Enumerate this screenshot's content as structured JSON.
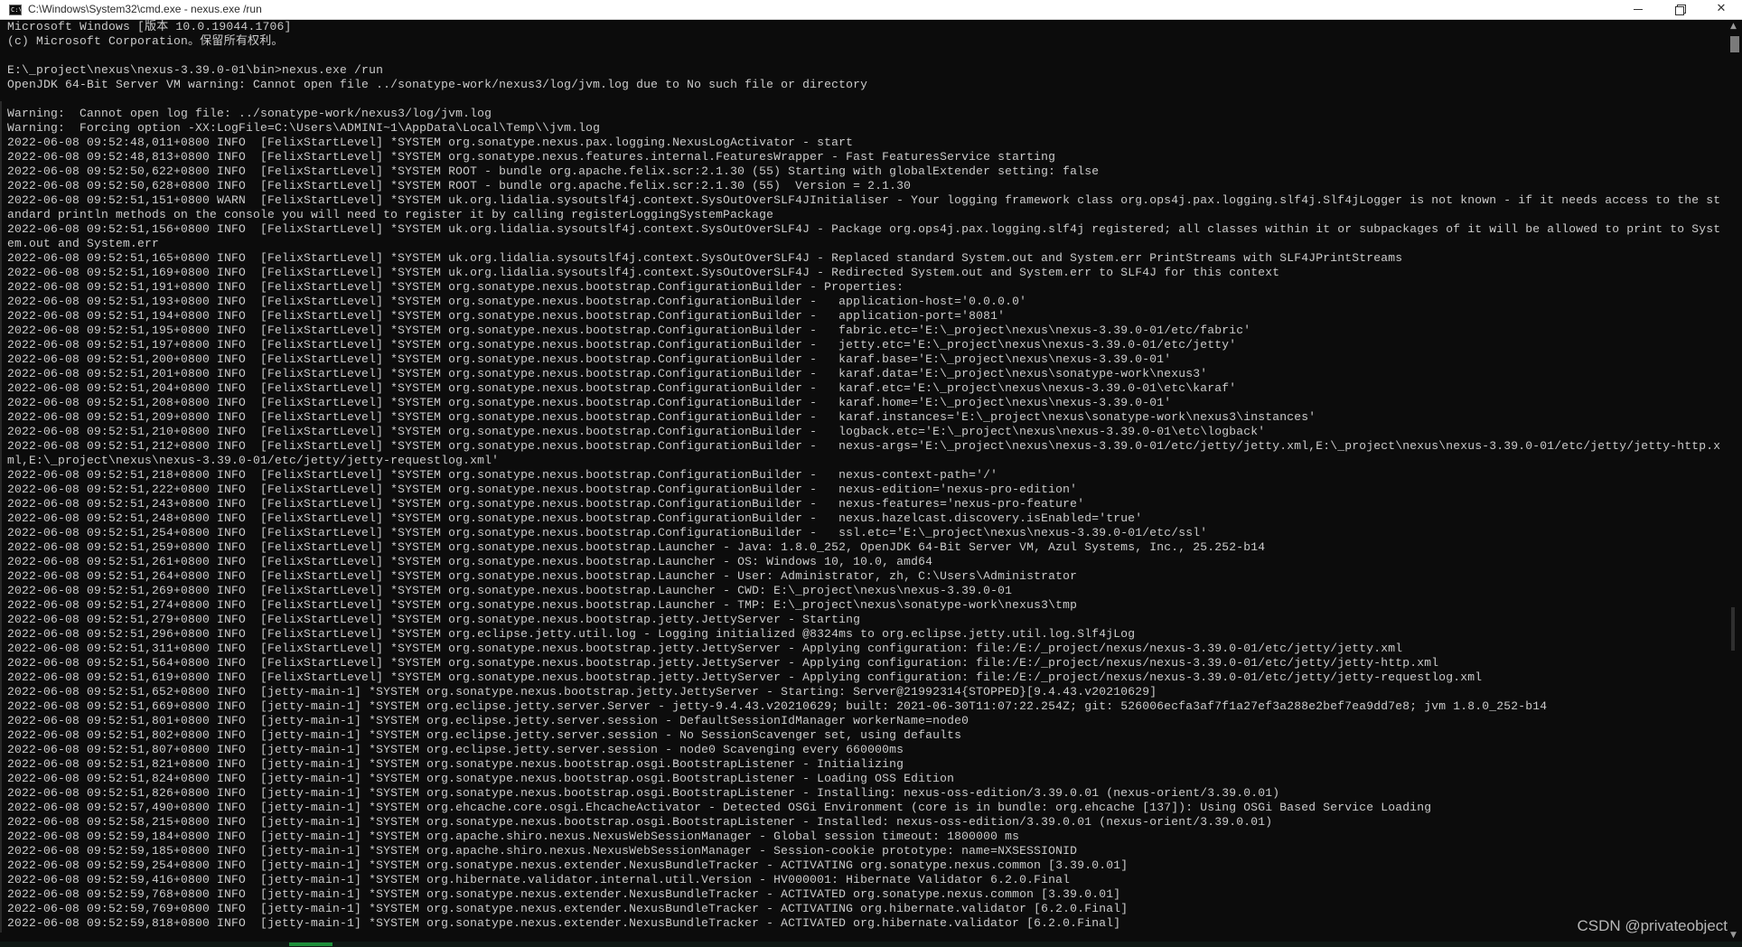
{
  "window": {
    "title": "C:\\Windows\\System32\\cmd.exe - nexus.exe  /run",
    "app_icon": "cmd-icon",
    "controls": {
      "minimize": "minimize-icon",
      "maximize": "restore-icon",
      "close_label": "✕"
    }
  },
  "console": {
    "lines": [
      "Microsoft Windows [版本 10.0.19044.1706]",
      "(c) Microsoft Corporation。保留所有权利。",
      "",
      "E:\\_project\\nexus\\nexus-3.39.0-01\\bin>nexus.exe /run",
      "OpenJDK 64-Bit Server VM warning: Cannot open file ../sonatype-work/nexus3/log/jvm.log due to No such file or directory",
      "",
      "Warning:  Cannot open log file: ../sonatype-work/nexus3/log/jvm.log",
      "Warning:  Forcing option -XX:LogFile=C:\\Users\\ADMINI~1\\AppData\\Local\\Temp\\\\jvm.log",
      "2022-06-08 09:52:48,011+0800 INFO  [FelixStartLevel] *SYSTEM org.sonatype.nexus.pax.logging.NexusLogActivator - start",
      "2022-06-08 09:52:48,813+0800 INFO  [FelixStartLevel] *SYSTEM org.sonatype.nexus.features.internal.FeaturesWrapper - Fast FeaturesService starting",
      "2022-06-08 09:52:50,622+0800 INFO  [FelixStartLevel] *SYSTEM ROOT - bundle org.apache.felix.scr:2.1.30 (55) Starting with globalExtender setting: false",
      "2022-06-08 09:52:50,628+0800 INFO  [FelixStartLevel] *SYSTEM ROOT - bundle org.apache.felix.scr:2.1.30 (55)  Version = 2.1.30",
      "2022-06-08 09:52:51,151+0800 WARN  [FelixStartLevel] *SYSTEM uk.org.lidalia.sysoutslf4j.context.SysOutOverSLF4JInitialiser - Your logging framework class org.ops4j.pax.logging.slf4j.Slf4jLogger is not known - if it needs access to the st",
      "andard println methods on the console you will need to register it by calling registerLoggingSystemPackage",
      "2022-06-08 09:52:51,156+0800 INFO  [FelixStartLevel] *SYSTEM uk.org.lidalia.sysoutslf4j.context.SysOutOverSLF4J - Package org.ops4j.pax.logging.slf4j registered; all classes within it or subpackages of it will be allowed to print to Syst",
      "em.out and System.err",
      "2022-06-08 09:52:51,165+0800 INFO  [FelixStartLevel] *SYSTEM uk.org.lidalia.sysoutslf4j.context.SysOutOverSLF4J - Replaced standard System.out and System.err PrintStreams with SLF4JPrintStreams",
      "2022-06-08 09:52:51,169+0800 INFO  [FelixStartLevel] *SYSTEM uk.org.lidalia.sysoutslf4j.context.SysOutOverSLF4J - Redirected System.out and System.err to SLF4J for this context",
      "2022-06-08 09:52:51,191+0800 INFO  [FelixStartLevel] *SYSTEM org.sonatype.nexus.bootstrap.ConfigurationBuilder - Properties:",
      "2022-06-08 09:52:51,193+0800 INFO  [FelixStartLevel] *SYSTEM org.sonatype.nexus.bootstrap.ConfigurationBuilder -   application-host='0.0.0.0'",
      "2022-06-08 09:52:51,194+0800 INFO  [FelixStartLevel] *SYSTEM org.sonatype.nexus.bootstrap.ConfigurationBuilder -   application-port='8081'",
      "2022-06-08 09:52:51,195+0800 INFO  [FelixStartLevel] *SYSTEM org.sonatype.nexus.bootstrap.ConfigurationBuilder -   fabric.etc='E:\\_project\\nexus\\nexus-3.39.0-01/etc/fabric'",
      "2022-06-08 09:52:51,197+0800 INFO  [FelixStartLevel] *SYSTEM org.sonatype.nexus.bootstrap.ConfigurationBuilder -   jetty.etc='E:\\_project\\nexus\\nexus-3.39.0-01/etc/jetty'",
      "2022-06-08 09:52:51,200+0800 INFO  [FelixStartLevel] *SYSTEM org.sonatype.nexus.bootstrap.ConfigurationBuilder -   karaf.base='E:\\_project\\nexus\\nexus-3.39.0-01'",
      "2022-06-08 09:52:51,201+0800 INFO  [FelixStartLevel] *SYSTEM org.sonatype.nexus.bootstrap.ConfigurationBuilder -   karaf.data='E:\\_project\\nexus\\sonatype-work\\nexus3'",
      "2022-06-08 09:52:51,204+0800 INFO  [FelixStartLevel] *SYSTEM org.sonatype.nexus.bootstrap.ConfigurationBuilder -   karaf.etc='E:\\_project\\nexus\\nexus-3.39.0-01\\etc\\karaf'",
      "2022-06-08 09:52:51,208+0800 INFO  [FelixStartLevel] *SYSTEM org.sonatype.nexus.bootstrap.ConfigurationBuilder -   karaf.home='E:\\_project\\nexus\\nexus-3.39.0-01'",
      "2022-06-08 09:52:51,209+0800 INFO  [FelixStartLevel] *SYSTEM org.sonatype.nexus.bootstrap.ConfigurationBuilder -   karaf.instances='E:\\_project\\nexus\\sonatype-work\\nexus3\\instances'",
      "2022-06-08 09:52:51,210+0800 INFO  [FelixStartLevel] *SYSTEM org.sonatype.nexus.bootstrap.ConfigurationBuilder -   logback.etc='E:\\_project\\nexus\\nexus-3.39.0-01\\etc\\logback'",
      "2022-06-08 09:52:51,212+0800 INFO  [FelixStartLevel] *SYSTEM org.sonatype.nexus.bootstrap.ConfigurationBuilder -   nexus-args='E:\\_project\\nexus\\nexus-3.39.0-01/etc/jetty/jetty.xml,E:\\_project\\nexus\\nexus-3.39.0-01/etc/jetty/jetty-http.x",
      "ml,E:\\_project\\nexus\\nexus-3.39.0-01/etc/jetty/jetty-requestlog.xml'",
      "2022-06-08 09:52:51,218+0800 INFO  [FelixStartLevel] *SYSTEM org.sonatype.nexus.bootstrap.ConfigurationBuilder -   nexus-context-path='/'",
      "2022-06-08 09:52:51,222+0800 INFO  [FelixStartLevel] *SYSTEM org.sonatype.nexus.bootstrap.ConfigurationBuilder -   nexus-edition='nexus-pro-edition'",
      "2022-06-08 09:52:51,243+0800 INFO  [FelixStartLevel] *SYSTEM org.sonatype.nexus.bootstrap.ConfigurationBuilder -   nexus-features='nexus-pro-feature'",
      "2022-06-08 09:52:51,248+0800 INFO  [FelixStartLevel] *SYSTEM org.sonatype.nexus.bootstrap.ConfigurationBuilder -   nexus.hazelcast.discovery.isEnabled='true'",
      "2022-06-08 09:52:51,254+0800 INFO  [FelixStartLevel] *SYSTEM org.sonatype.nexus.bootstrap.ConfigurationBuilder -   ssl.etc='E:\\_project\\nexus\\nexus-3.39.0-01/etc/ssl'",
      "2022-06-08 09:52:51,259+0800 INFO  [FelixStartLevel] *SYSTEM org.sonatype.nexus.bootstrap.Launcher - Java: 1.8.0_252, OpenJDK 64-Bit Server VM, Azul Systems, Inc., 25.252-b14",
      "2022-06-08 09:52:51,261+0800 INFO  [FelixStartLevel] *SYSTEM org.sonatype.nexus.bootstrap.Launcher - OS: Windows 10, 10.0, amd64",
      "2022-06-08 09:52:51,264+0800 INFO  [FelixStartLevel] *SYSTEM org.sonatype.nexus.bootstrap.Launcher - User: Administrator, zh, C:\\Users\\Administrator",
      "2022-06-08 09:52:51,269+0800 INFO  [FelixStartLevel] *SYSTEM org.sonatype.nexus.bootstrap.Launcher - CWD: E:\\_project\\nexus\\nexus-3.39.0-01",
      "2022-06-08 09:52:51,274+0800 INFO  [FelixStartLevel] *SYSTEM org.sonatype.nexus.bootstrap.Launcher - TMP: E:\\_project\\nexus\\sonatype-work\\nexus3\\tmp",
      "2022-06-08 09:52:51,279+0800 INFO  [FelixStartLevel] *SYSTEM org.sonatype.nexus.bootstrap.jetty.JettyServer - Starting",
      "2022-06-08 09:52:51,296+0800 INFO  [FelixStartLevel] *SYSTEM org.eclipse.jetty.util.log - Logging initialized @8324ms to org.eclipse.jetty.util.log.Slf4jLog",
      "2022-06-08 09:52:51,311+0800 INFO  [FelixStartLevel] *SYSTEM org.sonatype.nexus.bootstrap.jetty.JettyServer - Applying configuration: file:/E:/_project/nexus/nexus-3.39.0-01/etc/jetty/jetty.xml",
      "2022-06-08 09:52:51,564+0800 INFO  [FelixStartLevel] *SYSTEM org.sonatype.nexus.bootstrap.jetty.JettyServer - Applying configuration: file:/E:/_project/nexus/nexus-3.39.0-01/etc/jetty/jetty-http.xml",
      "2022-06-08 09:52:51,619+0800 INFO  [FelixStartLevel] *SYSTEM org.sonatype.nexus.bootstrap.jetty.JettyServer - Applying configuration: file:/E:/_project/nexus/nexus-3.39.0-01/etc/jetty/jetty-requestlog.xml",
      "2022-06-08 09:52:51,652+0800 INFO  [jetty-main-1] *SYSTEM org.sonatype.nexus.bootstrap.jetty.JettyServer - Starting: Server@21992314{STOPPED}[9.4.43.v20210629]",
      "2022-06-08 09:52:51,669+0800 INFO  [jetty-main-1] *SYSTEM org.eclipse.jetty.server.Server - jetty-9.4.43.v20210629; built: 2021-06-30T11:07:22.254Z; git: 526006ecfa3af7f1a27ef3a288e2bef7ea9dd7e8; jvm 1.8.0_252-b14",
      "2022-06-08 09:52:51,801+0800 INFO  [jetty-main-1] *SYSTEM org.eclipse.jetty.server.session - DefaultSessionIdManager workerName=node0",
      "2022-06-08 09:52:51,802+0800 INFO  [jetty-main-1] *SYSTEM org.eclipse.jetty.server.session - No SessionScavenger set, using defaults",
      "2022-06-08 09:52:51,807+0800 INFO  [jetty-main-1] *SYSTEM org.eclipse.jetty.server.session - node0 Scavenging every 660000ms",
      "2022-06-08 09:52:51,821+0800 INFO  [jetty-main-1] *SYSTEM org.sonatype.nexus.bootstrap.osgi.BootstrapListener - Initializing",
      "2022-06-08 09:52:51,824+0800 INFO  [jetty-main-1] *SYSTEM org.sonatype.nexus.bootstrap.osgi.BootstrapListener - Loading OSS Edition",
      "2022-06-08 09:52:51,826+0800 INFO  [jetty-main-1] *SYSTEM org.sonatype.nexus.bootstrap.osgi.BootstrapListener - Installing: nexus-oss-edition/3.39.0.01 (nexus-orient/3.39.0.01)",
      "2022-06-08 09:52:57,490+0800 INFO  [jetty-main-1] *SYSTEM org.ehcache.core.osgi.EhcacheActivator - Detected OSGi Environment (core is in bundle: org.ehcache [137]): Using OSGi Based Service Loading",
      "2022-06-08 09:52:58,215+0800 INFO  [jetty-main-1] *SYSTEM org.sonatype.nexus.bootstrap.osgi.BootstrapListener - Installed: nexus-oss-edition/3.39.0.01 (nexus-orient/3.39.0.01)",
      "2022-06-08 09:52:59,184+0800 INFO  [jetty-main-1] *SYSTEM org.apache.shiro.nexus.NexusWebSessionManager - Global session timeout: 1800000 ms",
      "2022-06-08 09:52:59,185+0800 INFO  [jetty-main-1] *SYSTEM org.apache.shiro.nexus.NexusWebSessionManager - Session-cookie prototype: name=NXSESSIONID",
      "2022-06-08 09:52:59,254+0800 INFO  [jetty-main-1] *SYSTEM org.sonatype.nexus.extender.NexusBundleTracker - ACTIVATING org.sonatype.nexus.common [3.39.0.01]",
      "2022-06-08 09:52:59,416+0800 INFO  [jetty-main-1] *SYSTEM org.hibernate.validator.internal.util.Version - HV000001: Hibernate Validator 6.2.0.Final",
      "2022-06-08 09:52:59,768+0800 INFO  [jetty-main-1] *SYSTEM org.sonatype.nexus.extender.NexusBundleTracker - ACTIVATED org.sonatype.nexus.common [3.39.0.01]",
      "2022-06-08 09:52:59,769+0800 INFO  [jetty-main-1] *SYSTEM org.sonatype.nexus.extender.NexusBundleTracker - ACTIVATING org.hibernate.validator [6.2.0.Final]",
      "2022-06-08 09:52:59,818+0800 INFO  [jetty-main-1] *SYSTEM org.sonatype.nexus.extender.NexusBundleTracker - ACTIVATED org.hibernate.validator [6.2.0.Final]"
    ]
  },
  "watermark": "CSDN @privateobject",
  "colors": {
    "console_bg": "#0c0c0c",
    "console_text": "#cccccc",
    "titlebar_bg": "#ffffff"
  }
}
